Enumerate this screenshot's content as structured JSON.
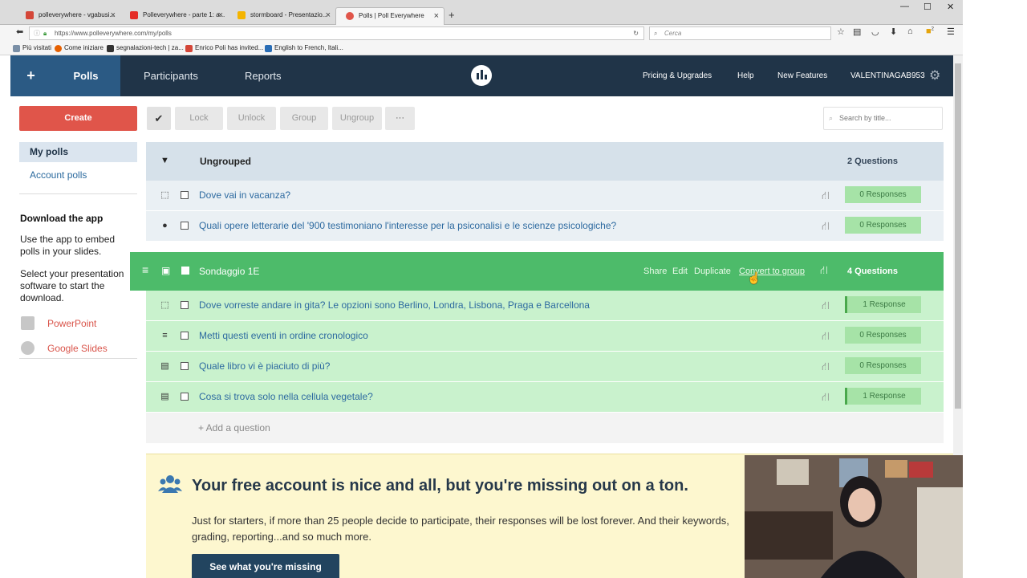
{
  "browser": {
    "tabs": [
      {
        "label": "polleverywhere - vgabusi...",
        "fav_color": "#d44638"
      },
      {
        "label": "Polleverywhere - parte 1: a...",
        "fav_color": "#e52d27"
      },
      {
        "label": "stormboard - Presentazio...",
        "fav_color": "#f4b400"
      },
      {
        "label": "Polls | Poll Everywhere",
        "fav_color": "#e0554a"
      }
    ],
    "new_tab": "+",
    "window": {
      "minimize": "—",
      "maximize": "☐",
      "close": "✕"
    },
    "url": "https://www.polleverywhere.com/my/polls",
    "search_placeholder": "Cerca",
    "bookmarks": [
      {
        "label": "Più visitati",
        "color": "#7a8fa6"
      },
      {
        "label": "Come iniziare",
        "color": "#e66000"
      },
      {
        "label": "segnalazioni-tech | za...",
        "color": "#333333"
      },
      {
        "label": "Enrico Poli has invited...",
        "color": "#d44638"
      },
      {
        "label": "English to French, Itali...",
        "color": "#2a6db5"
      }
    ],
    "notif_count": "2"
  },
  "header": {
    "plus": "+",
    "tabs": [
      "Polls",
      "Participants",
      "Reports"
    ],
    "right": [
      "Pricing & Upgrades",
      "Help",
      "New Features",
      "VALENTINAGAB953"
    ]
  },
  "sidebar": {
    "create": "Create",
    "my_polls": "My polls",
    "account_polls": "Account polls",
    "download_title": "Download the app",
    "download_text1": "Use the app to embed polls in your slides.",
    "download_text2": "Select your presentation software to start the download.",
    "links": [
      "PowerPoint",
      "Google Slides"
    ]
  },
  "toolbar": {
    "check": "✔",
    "buttons": [
      "Lock",
      "Unlock",
      "Group",
      "Ungroup",
      "···"
    ],
    "search_placeholder": "Search by title..."
  },
  "ungrouped": {
    "title": "Ungrouped",
    "count": "2 Questions",
    "rows": [
      {
        "icon": "⬚",
        "title": "Dove vai in vacanza?",
        "responses": "0 Responses"
      },
      {
        "icon": "●",
        "title": "Quali opere letterarie del '900 testimoniano l'interesse per la psiconalisi e le scienze psicologiche?",
        "responses": "0 Responses"
      }
    ]
  },
  "group": {
    "title": "Sondaggio 1E",
    "actions": [
      "Share",
      "Edit",
      "Duplicate",
      "Convert to group"
    ],
    "count": "4 Questions",
    "rows": [
      {
        "icon": "⬚",
        "title": "Dove vorreste andare in gita? Le opzioni sono Berlino, Londra, Lisbona, Praga e Barcellona",
        "responses": "1 Response"
      },
      {
        "icon": "≡",
        "title": "Metti questi eventi in ordine cronologico",
        "responses": "0 Responses"
      },
      {
        "icon": "▤",
        "title": "Quale libro vi è piaciuto di più?",
        "responses": "0 Responses"
      },
      {
        "icon": "▤",
        "title": "Cosa si trova solo nella cellula vegetale?",
        "responses": "1 Response"
      }
    ],
    "add_question": "+ Add a question"
  },
  "banner": {
    "title": "Your free account is nice and all, but you're missing out on a ton.",
    "text": "Just for starters, if more than 25 people decide to participate, their responses will be lost forever. And their keywords, grading, reporting...and so much more.",
    "button": "See what you're missing"
  },
  "colors": {
    "header": "#203448",
    "active_tab": "#2b5a84",
    "create": "#e0554a",
    "group_header": "#4dbb6a",
    "group_row": "#c9f2cd",
    "ungrouped_header": "#d6e1ea",
    "ungrouped_row": "#eaf0f4",
    "banner": "#fdf7cf"
  }
}
